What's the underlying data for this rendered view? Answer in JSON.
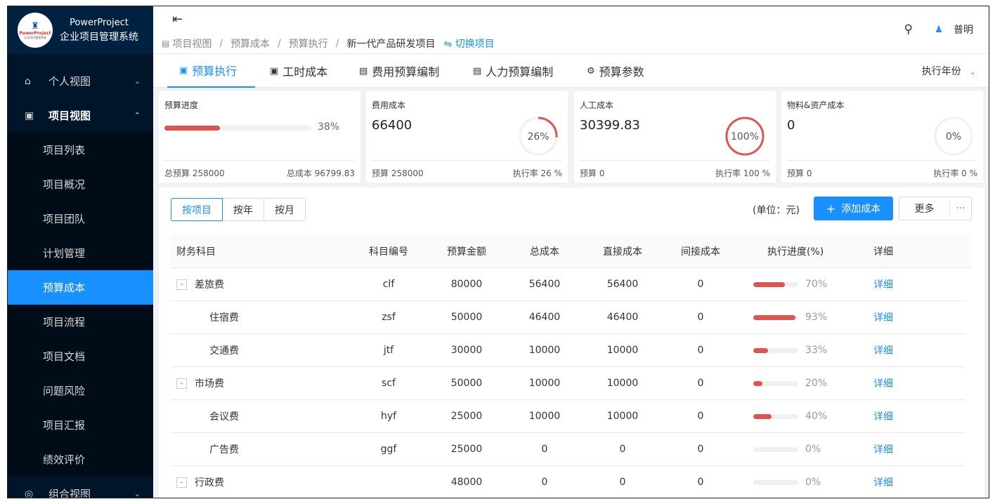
{
  "app": {
    "name": "PowerProject",
    "subtitle": "企业项目管理系统",
    "logo_brand": "PowerProject",
    "logo_sub": "企业项目管理系统"
  },
  "sidebar": {
    "groups": [
      {
        "label": "个人视图",
        "icon": "home-icon"
      },
      {
        "label": "项目视图",
        "icon": "project-icon"
      },
      {
        "label": "组合视图",
        "icon": "portfolio-icon"
      }
    ],
    "items": [
      {
        "label": "项目列表"
      },
      {
        "label": "项目概况"
      },
      {
        "label": "项目团队"
      },
      {
        "label": "计划管理"
      },
      {
        "label": "预算成本"
      },
      {
        "label": "项目流程"
      },
      {
        "label": "项目文档"
      },
      {
        "label": "问题风险"
      },
      {
        "label": "项目汇报"
      },
      {
        "label": "绩效评价"
      }
    ],
    "active_item": "预算成本"
  },
  "header": {
    "breadcrumb": [
      "项目视图",
      "预算成本",
      "预算执行",
      "新一代产品研发项目"
    ],
    "switch_label": "切换项目",
    "user_name": "普明",
    "search_icon": "search-icon",
    "collapse_icon": "menu-fold-icon"
  },
  "tabs": [
    {
      "label": "预算执行",
      "active": true
    },
    {
      "label": "工时成本"
    },
    {
      "label": "费用预算编制"
    },
    {
      "label": "人力预算编制"
    },
    {
      "label": "预算参数"
    }
  ],
  "year_select": {
    "label": "执行年份"
  },
  "cards": {
    "progress": {
      "title": "预算进度",
      "pct_label": "38%",
      "fraction": 0.38,
      "foot_left": "总预算 258000",
      "foot_right": "总成本 96799.83"
    },
    "expense": {
      "title": "费用成本",
      "value": "66400",
      "ring_label": "26%",
      "fraction": 0.26,
      "foot_left": "预算 258000",
      "foot_right": "执行率 26 %"
    },
    "labor": {
      "title": "人工成本",
      "value": "30399.83",
      "ring_label": "100%",
      "fraction": 1.0,
      "foot_left": "预算 0",
      "foot_right": "执行率 100 %"
    },
    "material": {
      "title": "物料&资产成本",
      "value": "0",
      "ring_label": "0%",
      "fraction": 0,
      "foot_left": "预算 0",
      "foot_right": "执行率 0 %"
    }
  },
  "toolbar": {
    "segments": [
      "按项目",
      "按年",
      "按月"
    ],
    "active_segment": "按项目",
    "unit": "(单位：元)",
    "add_label": "添加成本",
    "more_label": "更多",
    "more_dots": "···"
  },
  "table": {
    "headers": [
      "财务科目",
      "科目编号",
      "预算金额",
      "总成本",
      "直接成本",
      "间接成本",
      "执行进度(%)",
      "详细"
    ],
    "rows": [
      {
        "name": "差旅费",
        "code": "clf",
        "budget": "80000",
        "total": "56400",
        "direct": "56400",
        "indirect": "0",
        "progress": 0.7,
        "pct": "70%",
        "detail": "详细",
        "parent": true
      },
      {
        "name": "住宿费",
        "code": "zsf",
        "budget": "50000",
        "total": "46400",
        "direct": "46400",
        "indirect": "0",
        "progress": 0.93,
        "pct": "93%",
        "detail": "详细",
        "parent": false
      },
      {
        "name": "交通费",
        "code": "jtf",
        "budget": "30000",
        "total": "10000",
        "direct": "10000",
        "indirect": "0",
        "progress": 0.33,
        "pct": "33%",
        "detail": "详细",
        "parent": false
      },
      {
        "name": "市场费",
        "code": "scf",
        "budget": "50000",
        "total": "10000",
        "direct": "10000",
        "indirect": "0",
        "progress": 0.2,
        "pct": "20%",
        "detail": "详细",
        "parent": true
      },
      {
        "name": "会议费",
        "code": "hyf",
        "budget": "25000",
        "total": "10000",
        "direct": "10000",
        "indirect": "0",
        "progress": 0.4,
        "pct": "40%",
        "detail": "详细",
        "parent": false
      },
      {
        "name": "广告费",
        "code": "ggf",
        "budget": "25000",
        "total": "0",
        "direct": "0",
        "indirect": "0",
        "progress": 0,
        "pct": "0%",
        "detail": "详细",
        "parent": false
      },
      {
        "name": "行政费",
        "code": "",
        "budget": "48000",
        "total": "0",
        "direct": "0",
        "indirect": "0",
        "progress": 0,
        "pct": "0%",
        "detail": "详细",
        "parent": true
      }
    ],
    "expand_symbol": "-"
  },
  "colors": {
    "accent": "#1890ff",
    "sidebar_bg": "#001529",
    "danger": "#e0534f"
  }
}
